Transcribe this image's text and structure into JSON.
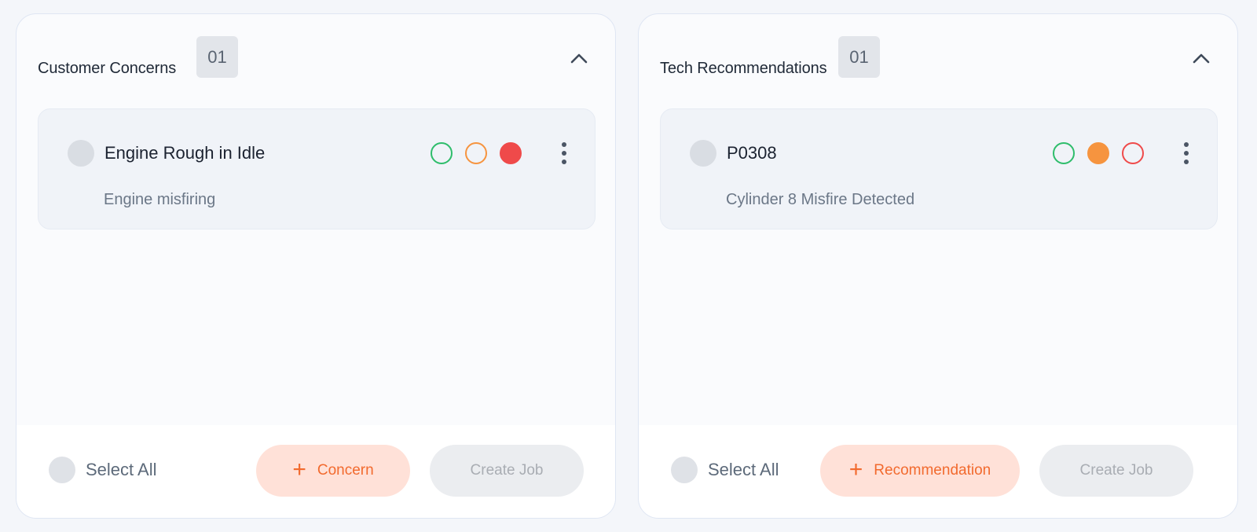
{
  "panels": [
    {
      "title": "Customer Concerns",
      "count": "01",
      "items": [
        {
          "title": "Engine Rough in Idle",
          "description": "Engine misfiring",
          "priority_selected": "high"
        }
      ],
      "select_all_label": "Select All",
      "add_button_label": "Concern",
      "create_job_label": "Create Job"
    },
    {
      "title": "Tech Recommendations",
      "count": "01",
      "items": [
        {
          "title": "P0308",
          "description": "Cylinder 8 Misfire Detected",
          "priority_selected": "medium"
        }
      ],
      "select_all_label": "Select All",
      "add_button_label": "Recommendation",
      "create_job_label": "Create Job"
    }
  ],
  "icons": {
    "collapse": "chevron-up-icon",
    "add": "plus-icon",
    "more": "more-vertical-icon"
  },
  "colors": {
    "priority_low": "#2ebd6b",
    "priority_medium": "#f6943f",
    "priority_high": "#ef4a4a",
    "accent": "#f26a2e",
    "accent_bg": "#ffe1d8"
  }
}
